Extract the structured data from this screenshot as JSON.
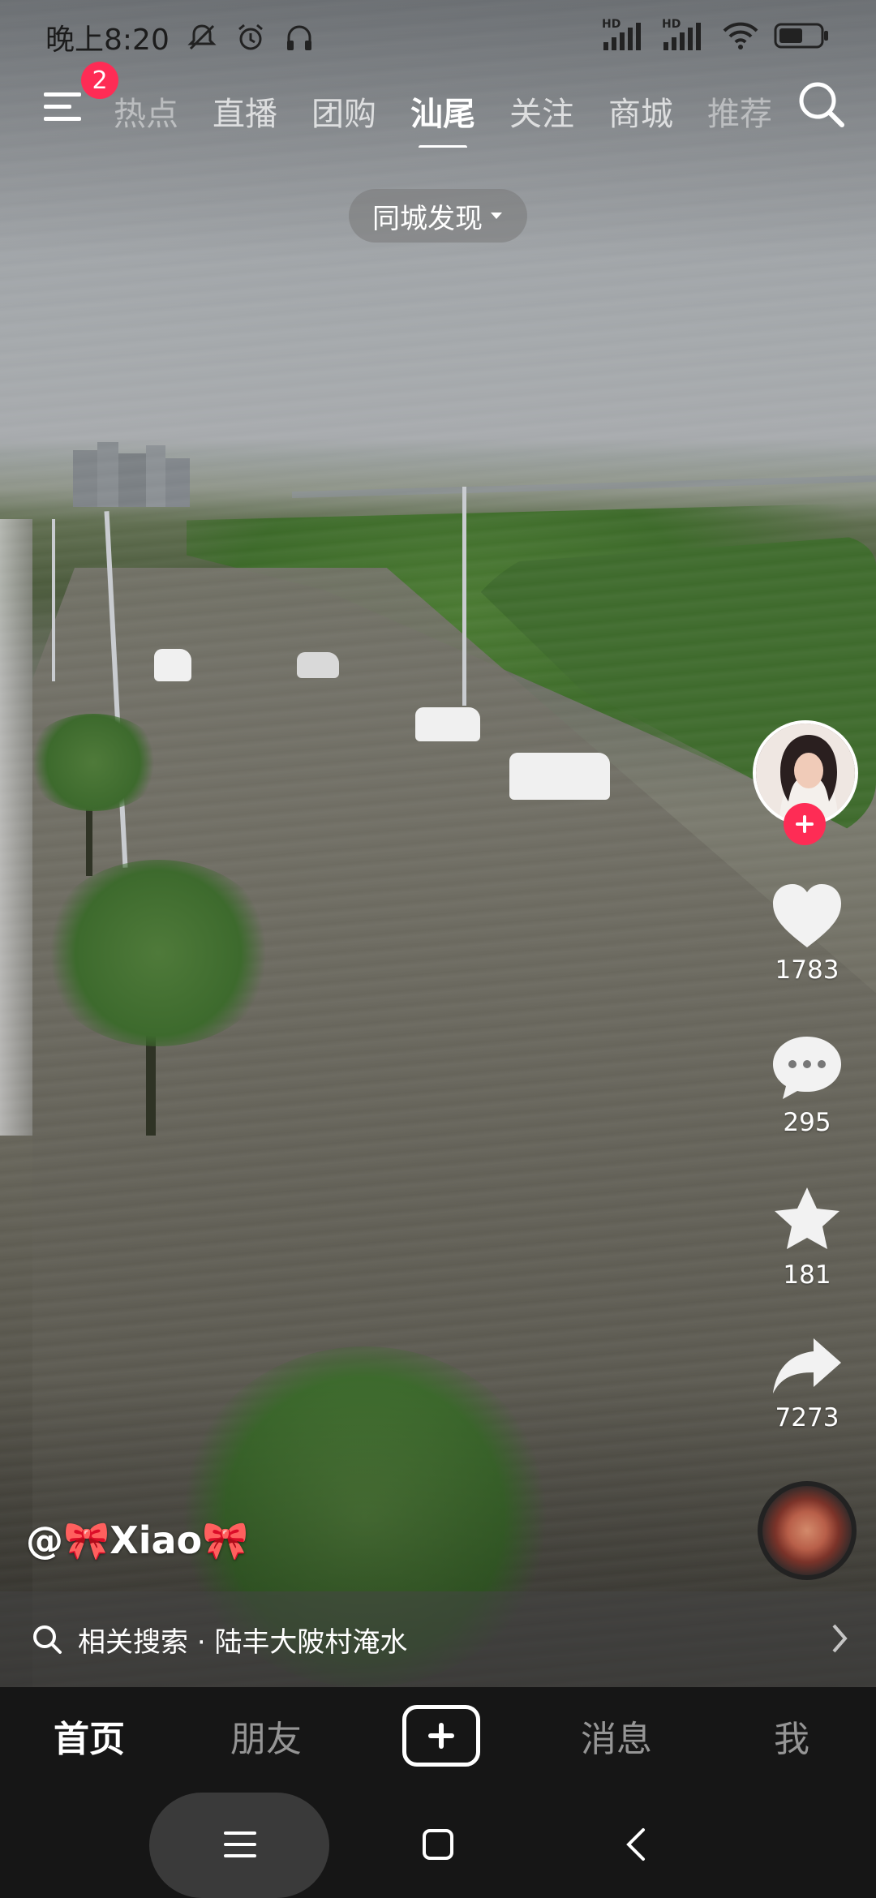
{
  "status_bar": {
    "time": "晚上8:20",
    "network_1": "HD",
    "network_2": "HD"
  },
  "top_nav": {
    "menu_badge": "2",
    "tabs": [
      "热点",
      "直播",
      "团购",
      "汕尾",
      "关注",
      "商城",
      "推荐"
    ],
    "active_tab": "汕尾"
  },
  "city_filter": {
    "label": "同城发现"
  },
  "actions": {
    "likes": "1783",
    "comments": "295",
    "favorites": "181",
    "shares": "7273"
  },
  "video": {
    "author": "@🎀Xiao🎀"
  },
  "related_search": {
    "prefix": "相关搜索",
    "separator": "·",
    "query": "陆丰大陂村淹水"
  },
  "bottom_nav": {
    "home": "首页",
    "friends": "朋友",
    "messages": "消息",
    "me": "我"
  },
  "colors": {
    "accent": "#fe2c55",
    "nav_bg": "#161616"
  }
}
